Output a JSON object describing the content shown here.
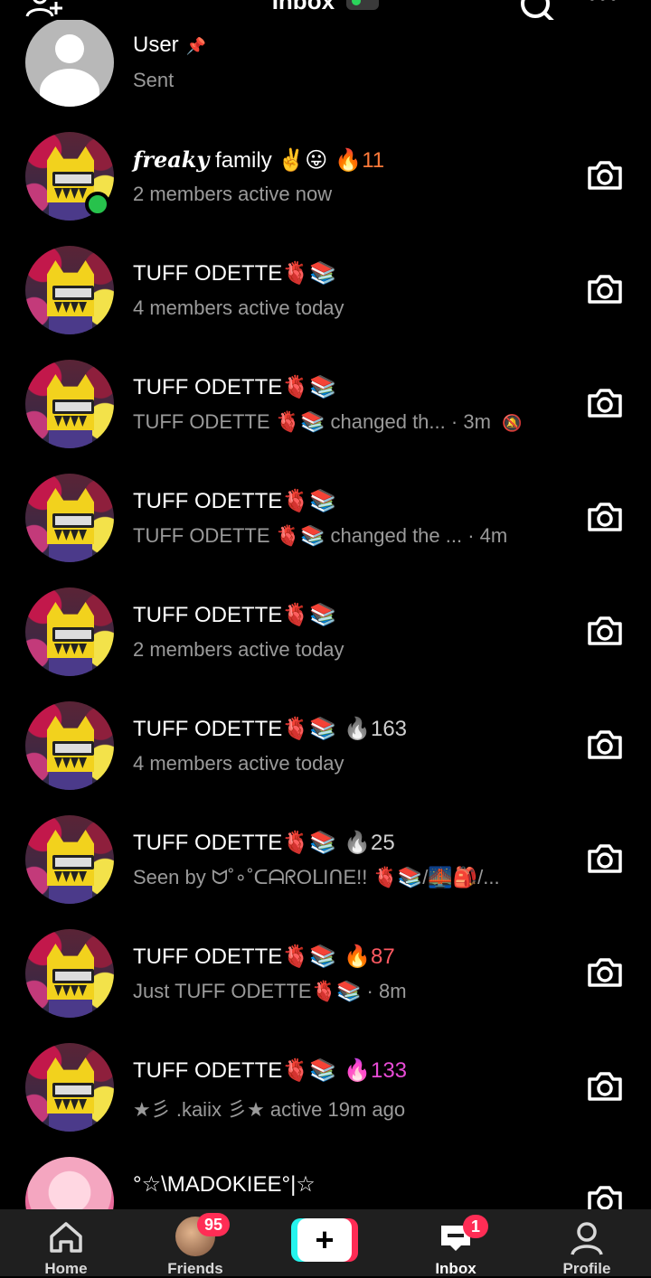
{
  "header": {
    "title": "Inbox",
    "add_friend_icon": "add-friend-icon",
    "search_icon": "search-icon",
    "more_icon": "more-icon"
  },
  "conversations": [
    {
      "name": "User",
      "sub": "Sent",
      "pinned": true,
      "avatar": "default-user",
      "camera": false
    },
    {
      "name_prefix": "freaky",
      "name": " family ✌️😛",
      "streak": "11",
      "streak_color": "#ff7a3a",
      "flame": "🔥",
      "sub": "2 members active now",
      "online": true,
      "camera": true
    },
    {
      "name": "TUFF ODETTE🫀📚",
      "sub": "4 members active today",
      "camera": true
    },
    {
      "name": "TUFF ODETTE🫀📚",
      "sub": "TUFF ODETTE 🫀📚 changed th...",
      "time": "· 3m",
      "muted": true,
      "camera": true
    },
    {
      "name": "TUFF ODETTE🫀📚",
      "sub": "TUFF ODETTE 🫀📚 changed the ...",
      "time": "· 4m",
      "camera": true
    },
    {
      "name": "TUFF ODETTE🫀📚",
      "sub": "2 members active today",
      "camera": true
    },
    {
      "name": "TUFF ODETTE🫀📚",
      "flame": "🔥",
      "streak": "163",
      "streak_color": "#cfcfcf",
      "sub": "4 members active today",
      "camera": true
    },
    {
      "name": "TUFF ODETTE🫀📚",
      "flame": "🔥",
      "streak": "25",
      "streak_color": "#cfcfcf",
      "sub": "Seen by ᗢ˚∘˚ᑕᗩᖇOᒪIᑎE!! 🫀📚/🌉🎒/...",
      "camera": true
    },
    {
      "name": "TUFF ODETTE🫀📚",
      "flame": "🔥",
      "streak": "87",
      "streak_color": "#ff5a62",
      "sub": "Just TUFF ODETTE🫀📚",
      "time": "· 8m",
      "camera": true
    },
    {
      "name": "TUFF ODETTE🫀📚",
      "flame": "🔥",
      "streak": "133",
      "streak_color": "#e84bd6",
      "sub": "★彡 .kaiix 彡★ active 19m ago",
      "camera": true
    },
    {
      "name": "°☆\\MADOKIEE°|☆",
      "sub": "",
      "avatar": "anime",
      "camera": true
    }
  ],
  "tabs": [
    {
      "label": "Home",
      "icon": "home-icon"
    },
    {
      "label": "Friends",
      "icon": "friends-avatar",
      "badge": "95"
    },
    {
      "label": "",
      "icon": "create-plus-icon"
    },
    {
      "label": "Inbox",
      "icon": "inbox-icon",
      "badge": "1",
      "active": true
    },
    {
      "label": "Profile",
      "icon": "profile-icon"
    }
  ]
}
